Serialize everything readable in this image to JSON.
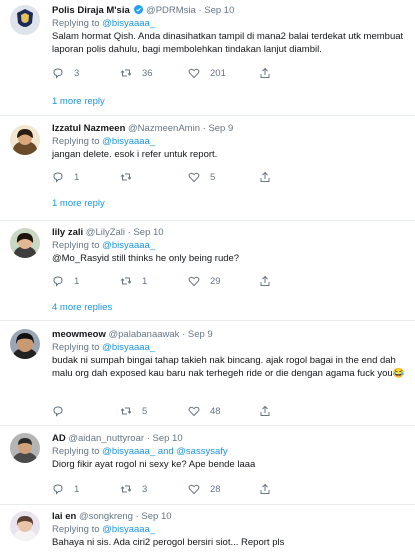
{
  "tweets": [
    {
      "name": "Polis Diraja M'sia",
      "handle": "@PDRMsia",
      "time": "Sep 10",
      "replying_prefix": "Replying to",
      "replying_to": "@bisyaaaa_",
      "text": "Salam hormat Qish. Anda dinasihatkan tampil di mana2 balai terdekat utk membuat laporan polis dahulu, bagi membolehkan tindakan lanjut diambil.",
      "replies": "3",
      "retweets": "36",
      "likes": "201",
      "more_replies": "1 more reply"
    },
    {
      "name": "Izzatul Nazmeen",
      "handle": "@NazmeenAmin",
      "time": "Sep 9",
      "replying_prefix": "Replying to",
      "replying_to": "@bisyaaaa_",
      "text": "jangan delete. esok i refer untuk report.",
      "replies": "1",
      "retweets": "",
      "likes": "5",
      "more_replies": "1 more reply"
    },
    {
      "name": "lily zali",
      "handle": "@LilyZali",
      "time": "Sep 10",
      "replying_prefix": "Replying to",
      "replying_to": "@bisyaaaa_",
      "text_mention": "@Mo_Rasyid",
      "text": " still thinks he only being rude?",
      "replies": "1",
      "retweets": "1",
      "likes": "29",
      "more_replies": "4 more replies"
    },
    {
      "name": "meowmeow",
      "handle": "@palabanaawak",
      "time": "Sep 9",
      "replying_prefix": "Replying to",
      "replying_to": "@bisyaaaa_",
      "text": "budak ni sumpah bingai tahap takieh nak bincang. ajak rogol bagai in the end dah malu org dah exposed kau baru nak terhegeh ride or die dengan agama fuck you😂",
      "replies": "",
      "retweets": "5",
      "likes": "48"
    },
    {
      "name": "AD",
      "handle": "@aidan_nuttyroar",
      "time": "Sep 10",
      "replying_prefix": "Replying to",
      "replying_to": "@bisyaaaa_",
      "replying_and": "and",
      "replying_to_2": "@sassysafy",
      "text": "Diorg fikir ayat rogol ni sexy ke? Ape bende laaa",
      "replies": "1",
      "retweets": "3",
      "likes": "28"
    },
    {
      "name": "lai en",
      "handle": "@songkreng",
      "time": "Sep 10",
      "replying_prefix": "Replying to",
      "replying_to": "@bisyaaaa_",
      "text": "Bahaya ni sis. Ada ciri2 perogol bersiri siot... Report pls"
    }
  ],
  "dot": "·",
  "icons": {
    "reply": "reply-icon",
    "retweet": "retweet-icon",
    "like": "heart-icon",
    "share": "share-icon",
    "verified": "verified-badge-icon"
  },
  "colors": {
    "link": "#1b95e0",
    "muted": "#657786",
    "text": "#14171a",
    "divider": "#e6ecf0"
  }
}
